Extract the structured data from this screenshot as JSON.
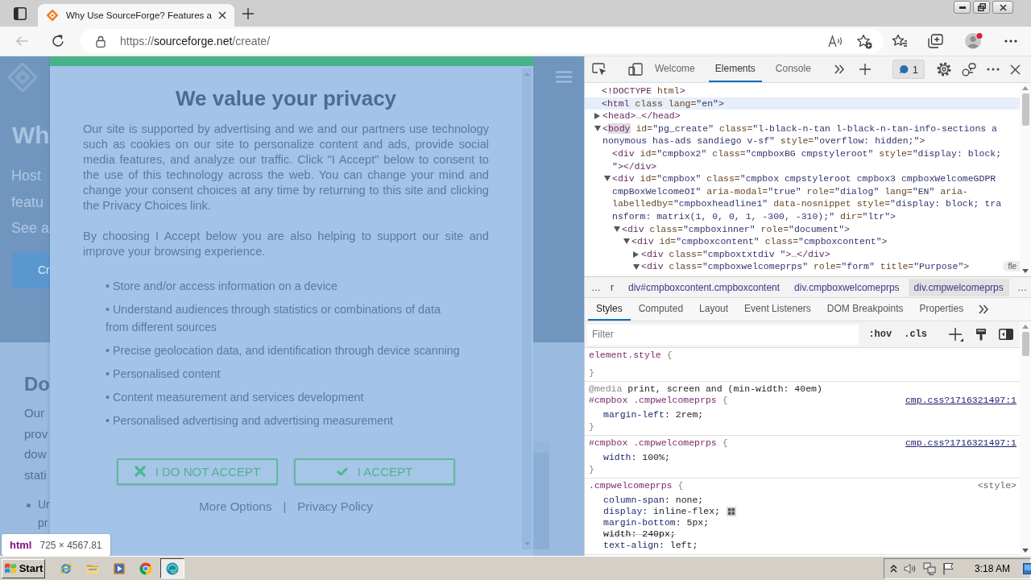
{
  "browser": {
    "tab": {
      "title": "Why Use SourceForge? Features a",
      "selected": true
    },
    "back": {
      "disabled": true
    },
    "url": {
      "scheme": "https://",
      "host": "sourceforge.net",
      "path": "/create/"
    }
  },
  "page": {
    "hero": {
      "heading": "Wh",
      "lines": [
        "Host",
        "featu",
        "See a"
      ],
      "button": "Cr"
    },
    "section": {
      "heading": "Do",
      "lines": [
        "Our",
        "prov",
        "dow",
        "stati"
      ],
      "list_item": [
        "Ur",
        "pr"
      ]
    }
  },
  "consent_dialog": {
    "title": "We value your privacy",
    "paragraphs": [
      "Our site is supported by advertising and we and our partners use technology such as cookies on our site to personalize content and ads, provide social media features, and analyze our traffic. Click \"I Accept\" below to consent to the use of this technology across the web. You can change your mind and change your consent choices at any time by returning to this site and clicking the Privacy Choices link.",
      "By choosing I Accept below you are also helping to support our site and improve your browsing experience."
    ],
    "purposes": [
      "• Store and/or access information on a device",
      "• Understand audiences through statistics or combinations of data from different sources",
      "• Precise geolocation data, and identification through device scanning",
      "• Personalised content",
      "• Content measurement and services development",
      "• Personalised advertising and advertising measurement"
    ],
    "buttons": [
      {
        "kind": "reject",
        "label": "I DO NOT ACCEPT"
      },
      {
        "kind": "accept",
        "label": "I ACCEPT"
      }
    ],
    "links": [
      "More Options",
      "Privacy Policy"
    ],
    "link_separator": "|"
  },
  "inspect_tooltip": {
    "tag": "html",
    "size": "725 × 4567.81"
  },
  "devtools": {
    "tabs": [
      {
        "label": "Welcome",
        "selected": false
      },
      {
        "label": "Elements",
        "selected": true
      },
      {
        "label": "Console",
        "selected": false
      }
    ],
    "issues_count": "1",
    "dom_tree": [
      {
        "lines": [
          "<!DOCTYPE html>"
        ],
        "hovered": false,
        "name_highlighted": false
      },
      {
        "lines": [
          "<html class lang=\"en\">"
        ],
        "hovered": true,
        "name_highlighted": false,
        "children": [
          {
            "lines": [
              "<head>…</head>"
            ],
            "expanded": false,
            "hovered": false,
            "name_highlighted": false
          },
          {
            "lines": [
              "<body id=\"pg_create\" class=\"l-black-n-tan l-black-n-tan-info-sections a",
              "nonymous has-ads sandiego v-sf\" style=\"overflow: hidden;\">"
            ],
            "expanded": true,
            "hovered": false,
            "name_highlighted": true,
            "children": [
              {
                "lines": [
                  "<div id=\"cmpbox2\" class=\"cmpboxBG cmpstyleroot\" style=\"display: block;",
                  "\"></div>"
                ],
                "hovered": false,
                "name_highlighted": false
              },
              {
                "lines": [
                  "<div id=\"cmpbox\" class=\"cmpbox cmpstyleroot cmpbox3 cmpboxWelcomeGDPR",
                  "cmpBoxWelcomeOI\" aria-modal=\"true\" role=\"dialog\" lang=\"EN\" aria-",
                  "labelledby=\"cmpboxheadline1\" data-nosnippet style=\"display: block; tra",
                  "nsform: matrix(1, 0, 0, 1, -300, -310);\" dir=\"ltr\">"
                ],
                "expanded": true,
                "hovered": false,
                "name_highlighted": false,
                "children": [
                  {
                    "lines": [
                      "<div class=\"cmpboxinner\" role=\"document\">"
                    ],
                    "expanded": true,
                    "hovered": false,
                    "name_highlighted": false,
                    "children": [
                      {
                        "lines": [
                          "<div id=\"cmpboxcontent\" class=\"cmpboxcontent\">"
                        ],
                        "expanded": true,
                        "hovered": false,
                        "name_highlighted": false,
                        "children": [
                          {
                            "lines": [
                              "<div class=\"cmpboxtxtdiv \">…</div>"
                            ],
                            "expanded": false,
                            "hovered": false,
                            "name_highlighted": false
                          },
                          {
                            "lines": [
                              "<div class=\"cmpboxwelcomeprps\" role=\"form\" title=\"Purpose\">"
                            ],
                            "expanded": true,
                            "hovered": false,
                            "name_highlighted": false,
                            "badge": "fle"
                          }
                        ]
                      }
                    ]
                  }
                ]
              }
            ]
          }
        ]
      }
    ],
    "breadcrumbs": {
      "overflow_left": "…",
      "items": [
        {
          "text": "r",
          "selected": false
        },
        {
          "text": "div#cmpboxcontent.cmpboxcontent",
          "selected": false
        },
        {
          "text": "div.cmpboxwelcomeprps",
          "selected": false
        },
        {
          "text": "div.cmpwelcomeprps",
          "selected": true
        }
      ],
      "overflow_right": "…"
    },
    "styles_tabs": [
      {
        "label": "Styles",
        "selected": true
      },
      {
        "label": "Computed",
        "selected": false
      },
      {
        "label": "Layout",
        "selected": false
      },
      {
        "label": "Event Listeners",
        "selected": false
      },
      {
        "label": "DOM Breakpoints",
        "selected": false
      },
      {
        "label": "Properties",
        "selected": false
      }
    ],
    "filter": {
      "placeholder": "Filter"
    },
    "filter_toggles": [
      ":hov",
      ".cls"
    ],
    "rules": [
      {
        "selector": "element.style",
        "open_brace": "{",
        "close_brace": "}"
      },
      {
        "media": "@media print, screen and (min-width: 40em)",
        "selector": "#cmpbox .cmpwelcomeprps",
        "open_brace": "{",
        "source": {
          "kind": "file",
          "text": "cmp.css?1716321497:1"
        },
        "declarations": [
          {
            "text": "margin-left: 2rem;",
            "overridden": false,
            "editor": false
          }
        ],
        "close_brace": "}"
      },
      {
        "selector": "#cmpbox .cmpwelcomeprps",
        "open_brace": "{",
        "source": {
          "kind": "file",
          "text": "cmp.css?1716321497:1"
        },
        "declarations": [
          {
            "text": "width: 100%;",
            "overridden": false,
            "editor": false
          }
        ],
        "close_brace": "}"
      },
      {
        "selector": ".cmpwelcomeprps",
        "open_brace": "{",
        "source": {
          "kind": "inline",
          "text": "<style>"
        },
        "declarations": [
          {
            "text": "column-span: none;",
            "overridden": false,
            "editor": false
          },
          {
            "text": "display: inline-flex;",
            "overridden": false,
            "editor": true
          },
          {
            "text": "margin-bottom: 5px;",
            "overridden": false,
            "editor": false
          },
          {
            "text": "width: 240px;",
            "overridden": true,
            "editor": false
          },
          {
            "text": "text-align: left;",
            "overridden": false,
            "editor": false
          }
        ]
      }
    ]
  },
  "taskbar": {
    "start": "Start",
    "apps": [
      {
        "selected": false
      },
      {
        "selected": false
      },
      {
        "selected": false
      },
      {
        "selected": false
      },
      {
        "selected": true
      }
    ],
    "clock": "3:18 AM"
  }
}
